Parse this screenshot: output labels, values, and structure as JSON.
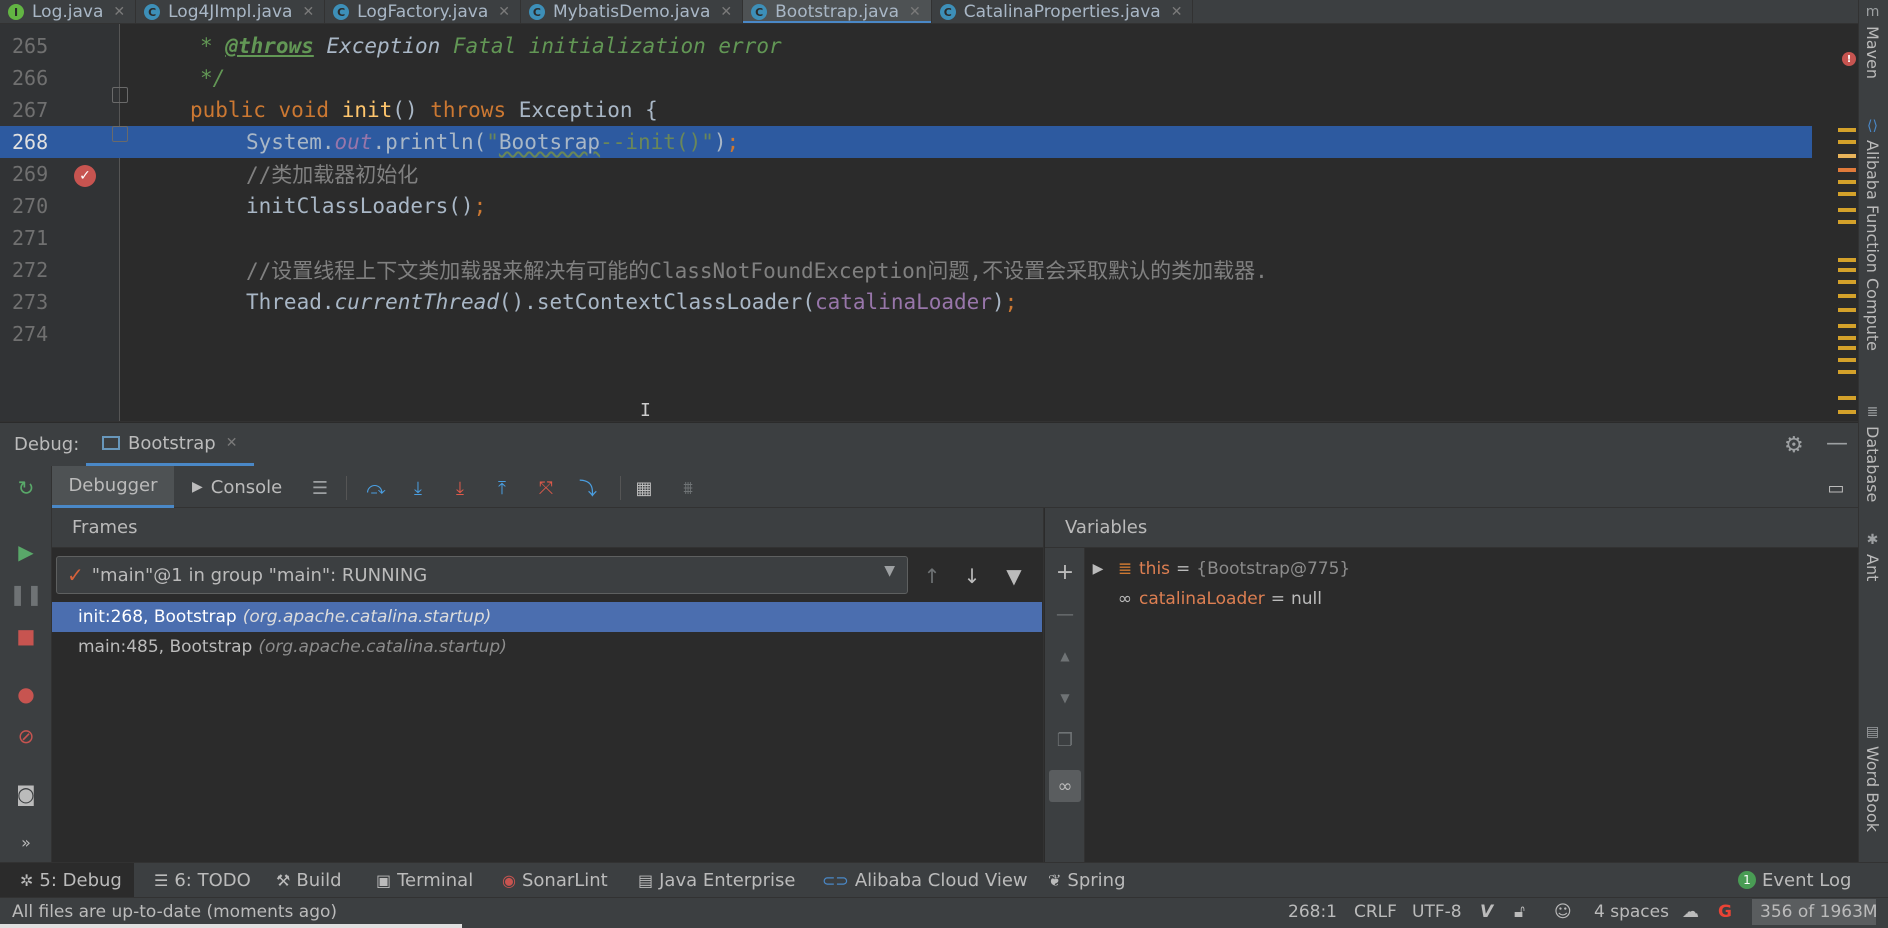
{
  "tabs": [
    {
      "label": "Log.java",
      "icon": "interface-icon",
      "active": false
    },
    {
      "label": "Log4JImpl.java",
      "icon": "class-icon",
      "active": false
    },
    {
      "label": "LogFactory.java",
      "icon": "class-icon",
      "active": false
    },
    {
      "label": "MybatisDemo.java",
      "icon": "class-icon",
      "active": false
    },
    {
      "label": "Bootstrap.java",
      "icon": "class-icon",
      "active": true
    },
    {
      "label": "CatalinaProperties.java",
      "icon": "class-icon",
      "active": false
    }
  ],
  "editor": {
    "current_line": 268,
    "lines": [
      {
        "num": "265",
        "parts": [
          [
            "docplain",
            "* "
          ],
          [
            "doctag",
            "@throws"
          ],
          [
            "docplain",
            " "
          ],
          [
            "ital",
            "Exception"
          ],
          [
            "doc",
            " Fatal initialization error"
          ]
        ],
        "indent": 1
      },
      {
        "num": "266",
        "parts": [
          [
            "docplain",
            "*/"
          ]
        ],
        "indent": 1
      },
      {
        "num": "267",
        "parts": [
          [
            "kw",
            "public void "
          ],
          [
            "fn",
            "init"
          ],
          [
            "plain",
            "() "
          ],
          [
            "kw",
            "throws "
          ],
          [
            "plain",
            "Exception {"
          ]
        ],
        "indent": 0
      },
      {
        "num": "268",
        "parts": [
          [
            "plain",
            "System."
          ],
          [
            "fld",
            "out"
          ],
          [
            "plain",
            ".println("
          ],
          [
            "str",
            "\""
          ],
          [
            "strsq",
            "Bootsrap"
          ],
          [
            "str",
            "--init()\""
          ],
          [
            "plain",
            ")"
          ],
          [
            "kw",
            ";"
          ]
        ],
        "indent": 2
      },
      {
        "num": "269",
        "parts": [
          [
            "cmt",
            "//类加载器初始化"
          ]
        ],
        "indent": 2
      },
      {
        "num": "270",
        "parts": [
          [
            "plain",
            "initClassLoaders()"
          ],
          [
            "kw",
            ";"
          ]
        ],
        "indent": 2
      },
      {
        "num": "271",
        "parts": [],
        "indent": 2
      },
      {
        "num": "272",
        "parts": [
          [
            "cmt",
            "//设置线程上下文类加载器来解决有可能的ClassNotFoundException问题,不设置会采取默认的类加载器."
          ]
        ],
        "indent": 2
      },
      {
        "num": "273",
        "parts": [
          [
            "plain",
            "Thread."
          ],
          [
            "ital",
            "currentThread"
          ],
          [
            "plain",
            "().setContextClassLoader("
          ],
          [
            "var",
            "catalinaLoader"
          ],
          [
            "plain",
            ")"
          ],
          [
            "kw",
            ";"
          ]
        ],
        "indent": 2
      },
      {
        "num": "274",
        "parts": [],
        "indent": 2
      }
    ]
  },
  "right_strip": [
    "Maven",
    "Alibaba Function Compute",
    "Database",
    "Ant",
    "Word Book"
  ],
  "debug": {
    "label": "Debug:",
    "session": "Bootstrap",
    "subtabs": {
      "debugger": "Debugger",
      "console": "Console"
    },
    "frames": {
      "title": "Frames",
      "thread": "\"main\"@1 in group \"main\": RUNNING",
      "items": [
        {
          "method": "init:268, Bootstrap",
          "pkg": "(org.apache.catalina.startup)",
          "selected": true
        },
        {
          "method": "main:485, Bootstrap",
          "pkg": "(org.apache.catalina.startup)",
          "selected": false
        }
      ]
    },
    "variables": {
      "title": "Variables",
      "items": [
        {
          "name": "this",
          "value": "{Bootstrap@775}",
          "expandable": true,
          "icon": "object-icon"
        },
        {
          "name": "catalinaLoader",
          "value": "null",
          "expandable": false,
          "icon": "watch-icon"
        }
      ]
    }
  },
  "toolwindows": [
    {
      "label": "5: Debug",
      "icon": "bug-icon"
    },
    {
      "label": "6: TODO",
      "icon": "list-icon"
    },
    {
      "label": "Build",
      "icon": "hammer-icon"
    },
    {
      "label": "Terminal",
      "icon": "terminal-icon"
    },
    {
      "label": "SonarLint",
      "icon": "sonarlint-icon"
    },
    {
      "label": "Java Enterprise",
      "icon": "enterprise-icon"
    },
    {
      "label": "Alibaba Cloud View",
      "icon": "cloud-icon"
    },
    {
      "label": "Spring",
      "icon": "spring-icon"
    },
    {
      "label": "Event Log",
      "icon": "event-log-icon",
      "badge": "1"
    }
  ],
  "status": {
    "message": "All files are up-to-date (moments ago)",
    "position": "268:1",
    "line_sep": "CRLF",
    "encoding": "UTF-8",
    "indent": "4 spaces",
    "memory": "356 of 1963M"
  }
}
